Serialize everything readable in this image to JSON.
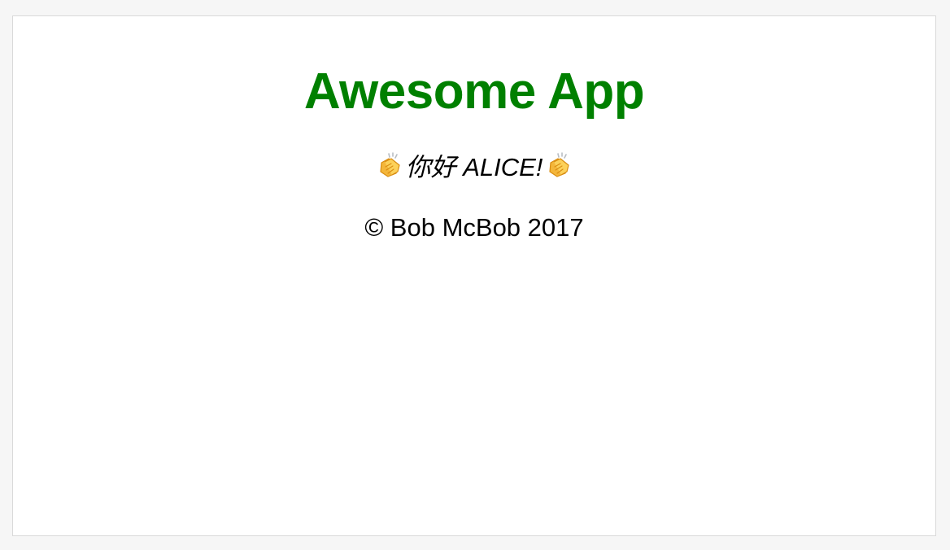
{
  "app": {
    "title": "Awesome App",
    "title_color": "#008000"
  },
  "greeting": {
    "text": "你好 ALICE!",
    "left_icon": "clapping-hands-icon",
    "right_icon": "clapping-hands-icon"
  },
  "footer": {
    "text": "© Bob McBob 2017"
  }
}
